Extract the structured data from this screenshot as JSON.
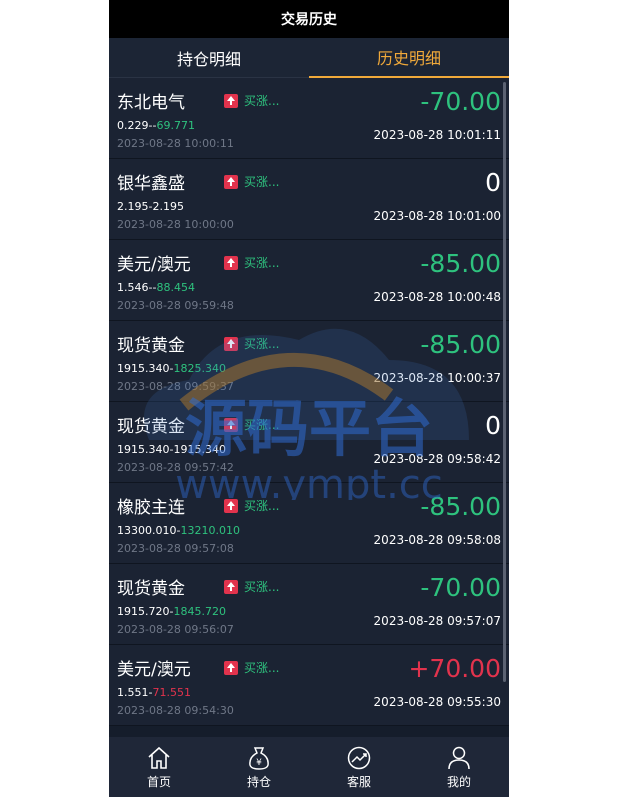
{
  "header": {
    "title": "交易历史"
  },
  "tabs": [
    {
      "label": "持仓明细",
      "active": false
    },
    {
      "label": "历史明细",
      "active": true
    }
  ],
  "records": [
    {
      "name": "东北电气",
      "direction": "买涨...",
      "open_price": "0.229",
      "sep": "--",
      "close_price": "69.771",
      "close_color": "green",
      "open_time": "2023-08-28 10:00:11",
      "pnl": "-70.00",
      "pnl_color": "green",
      "close_time": "2023-08-28 10:01:11"
    },
    {
      "name": "银华鑫盛",
      "direction": "买涨...",
      "open_price": "2.195",
      "sep": "-",
      "close_price": "2.195",
      "close_color": "white",
      "open_time": "2023-08-28 10:00:00",
      "pnl": "0",
      "pnl_color": "white",
      "close_time": "2023-08-28 10:01:00"
    },
    {
      "name": "美元/澳元",
      "direction": "买涨...",
      "open_price": "1.546",
      "sep": "--",
      "close_price": "88.454",
      "close_color": "green",
      "open_time": "2023-08-28 09:59:48",
      "pnl": "-85.00",
      "pnl_color": "green",
      "close_time": "2023-08-28 10:00:48"
    },
    {
      "name": "现货黄金",
      "direction": "买涨...",
      "open_price": "1915.340",
      "sep": "-",
      "close_price": "1825.340",
      "close_color": "green",
      "open_time": "2023-08-28 09:59:37",
      "pnl": "-85.00",
      "pnl_color": "green",
      "close_time": "2023-08-28 10:00:37"
    },
    {
      "name": "现货黄金",
      "direction": "买涨...",
      "open_price": "1915.340",
      "sep": "-",
      "close_price": "1915.340",
      "close_color": "white",
      "open_time": "2023-08-28 09:57:42",
      "pnl": "0",
      "pnl_color": "white",
      "close_time": "2023-08-28 09:58:42"
    },
    {
      "name": "橡胶主连",
      "direction": "买涨...",
      "open_price": "13300.010",
      "sep": "-",
      "close_price": "13210.010",
      "close_color": "green",
      "open_time": "2023-08-28 09:57:08",
      "pnl": "-85.00",
      "pnl_color": "green",
      "close_time": "2023-08-28 09:58:08"
    },
    {
      "name": "现货黄金",
      "direction": "买涨...",
      "open_price": "1915.720",
      "sep": "-",
      "close_price": "1845.720",
      "close_color": "green",
      "open_time": "2023-08-28 09:56:07",
      "pnl": "-70.00",
      "pnl_color": "green",
      "close_time": "2023-08-28 09:57:07"
    },
    {
      "name": "美元/澳元",
      "direction": "买涨...",
      "open_price": "1.551",
      "sep": "-",
      "close_price": "71.551",
      "close_color": "red",
      "open_time": "2023-08-28 09:54:30",
      "pnl": "+70.00",
      "pnl_color": "red",
      "close_time": "2023-08-28 09:55:30"
    }
  ],
  "watermark": {
    "text1": "源码平台",
    "text2": "www.ympt.cc"
  },
  "bottom_nav": [
    {
      "label": "首页",
      "icon": "home-icon"
    },
    {
      "label": "持仓",
      "icon": "money-bag-icon"
    },
    {
      "label": "客服",
      "icon": "trend-chart-icon"
    },
    {
      "label": "我的",
      "icon": "user-icon"
    }
  ],
  "colors": {
    "green": "#2ec27e",
    "red": "#e2334d",
    "accent": "#f0a93a",
    "background": "#151d2b"
  }
}
